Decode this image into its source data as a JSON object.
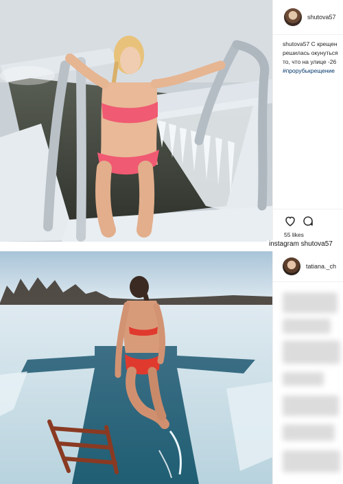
{
  "post1": {
    "username": "shutova57",
    "caption_user": "shutova57",
    "caption_lines": [
      "С крещен",
      "решилась окунуться",
      "то, что на улице -26"
    ],
    "hashtag": "#прорубькрещение",
    "likes": "55 likes"
  },
  "watermark": "instagram shutova57",
  "post2": {
    "username": "tatiana._ch"
  },
  "icons": [
    "heart-icon",
    "comment-icon"
  ],
  "colors": {
    "text": "#262626",
    "hashtag": "#003569",
    "border": "#efefef"
  }
}
